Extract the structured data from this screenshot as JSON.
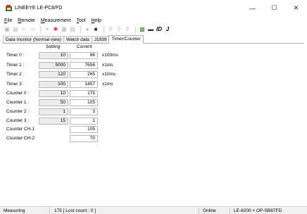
{
  "window": {
    "title": "LINEEYE LE-PC8/FD",
    "min_glyph": "—",
    "max_glyph": "☐",
    "close_glyph": "✕"
  },
  "menu": {
    "file": {
      "ul": "F",
      "rest": "ile"
    },
    "remote": {
      "ul": "R",
      "rest": "emote"
    },
    "measurement": {
      "ul": "M",
      "rest": "easurement"
    },
    "tool": {
      "ul": "T",
      "rest": "ool"
    },
    "help": {
      "ul": "H",
      "rest": "elp"
    }
  },
  "toolbar": {
    "id_label": "ID",
    "j_label": "J"
  },
  "tabs": [
    {
      "label": "Data monitor (Normal view)"
    },
    {
      "label": "Watch data"
    },
    {
      "label": "J1939"
    },
    {
      "label": "Timer/Counter",
      "active": true
    }
  ],
  "table": {
    "col_setting": "Setting",
    "col_current": "Current",
    "rows": [
      {
        "label": "Timer 0 :",
        "setting": "10",
        "current": "86",
        "unit": "x100ms"
      },
      {
        "label": "Timer 1 :",
        "setting": "5000",
        "current": "7656",
        "unit": "x1ms"
      },
      {
        "label": "Timer 2 :",
        "setting": "120",
        "current": "265",
        "unit": "x10ms"
      },
      {
        "label": "Timer 3 :",
        "setting": "100",
        "current": "1457",
        "unit": "x1ms"
      },
      {
        "label": "Counter 0 :",
        "setting": "10",
        "current": "175",
        "unit": ""
      },
      {
        "label": "Counter 1 :",
        "setting": "50",
        "current": "105",
        "unit": ""
      },
      {
        "label": "Counter 2 :",
        "setting": "1",
        "current": "3",
        "unit": ""
      },
      {
        "label": "Counter 3 :",
        "setting": "15",
        "current": "1",
        "unit": ""
      },
      {
        "label": "Counter CH-1",
        "setting": null,
        "current": "105",
        "unit": ""
      },
      {
        "label": "Counter CH-2",
        "setting": null,
        "current": "70",
        "unit": ""
      }
    ]
  },
  "status": {
    "state": "Measuring",
    "count": "175 [ Lost count : 0 ]",
    "connection": "Online",
    "device": "LE-8200 + OP-SB87FD"
  }
}
